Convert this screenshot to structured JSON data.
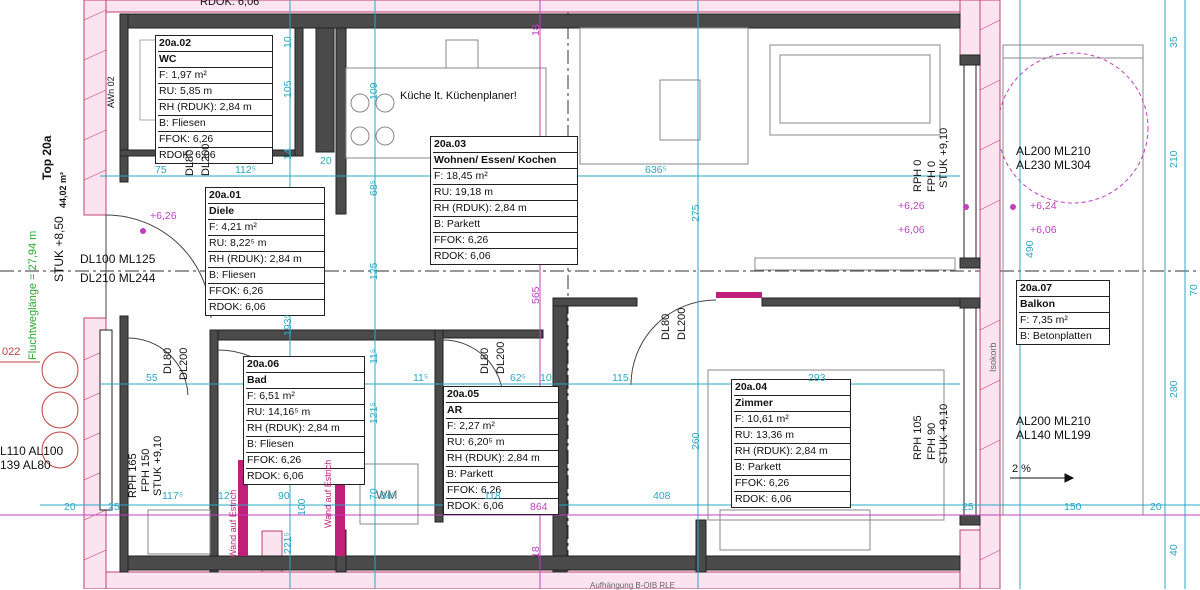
{
  "rooms": [
    {
      "id": "wc",
      "number": "20a.02",
      "name": "WC",
      "rows": [
        "F: 1,97 m²",
        "RU: 5,85 m",
        "RH (RDUK): 2,84 m",
        "B: Fliesen",
        "FFOK: 6,26",
        "RDOK: 6,06"
      ]
    },
    {
      "id": "diele",
      "number": "20a.01",
      "name": "Diele",
      "rows": [
        "F: 4,21 m²",
        "RU: 8,22⁵ m",
        "RH (RDUK): 2,84 m",
        "B: Fliesen",
        "FFOK: 6,26",
        "RDOK: 6,06"
      ]
    },
    {
      "id": "wohnen",
      "number": "20a.03",
      "name": "Wohnen/ Essen/ Kochen",
      "rows": [
        "F: 18,45 m²",
        "RU: 19,18 m",
        "RH (RDUK): 2,84 m",
        "B: Parkett",
        "FFOK: 6,26",
        "RDOK: 6,06"
      ]
    },
    {
      "id": "bad",
      "number": "20a.06",
      "name": "Bad",
      "rows": [
        "F: 6,51 m²",
        "RU: 14,16⁵ m",
        "RH (RDUK): 2,84 m",
        "B: Fliesen",
        "FFOK: 6,26",
        "RDOK: 6,06"
      ]
    },
    {
      "id": "ar",
      "number": "20a.05",
      "name": "AR",
      "rows": [
        "F: 2,27 m²",
        "RU: 6,20⁵ m",
        "RH (RDUK): 2,84 m",
        "B: Parkett",
        "FFOK: 6,26",
        "RDOK: 6,06"
      ]
    },
    {
      "id": "zimmer",
      "number": "20a.04",
      "name": "Zimmer",
      "rows": [
        "F: 10,61 m²",
        "RU: 13,36 m",
        "RH (RDUK): 2,84 m",
        "B: Parkett",
        "FFOK: 6,26",
        "RDOK: 6,06"
      ]
    },
    {
      "id": "balkon",
      "number": "20a.07",
      "name": "Balkon",
      "rows": [
        "F: 7,35 m²",
        "B: Betonplatten"
      ]
    }
  ],
  "notes": {
    "kitchen": "Küche lt. Küchenplaner!",
    "unit_top": "Top 20a",
    "unit_area": "44,02 m²",
    "escape_route": "Fluchtweglänge = 27,94 m",
    "wm": "WM",
    "awn": "AWn 02",
    "isokorb": "Isokorb",
    "slope": "2 %",
    "rdok_top": "RDOK: 6,06",
    "lower_text": "Aufhängung B-OIB RLE",
    "wall_note": "Wand auf Estrich",
    "level_022": "022"
  },
  "openings": {
    "entry_dl": "DL100  ML125",
    "entry_dl2": "DL210  ML244",
    "entry_stuk": "STUK +8,50",
    "door_dl80": "DL80",
    "door_dl200": "DL200",
    "win_top_1": "AL200  ML210",
    "win_top_2": "AL230  ML304",
    "win_low_1": "AL200  ML210",
    "win_low_2": "AL140  ML199",
    "left_win_1": "L110  AL100",
    "left_win_2": "139  AL80",
    "rph_top": "RPH 0",
    "fph_top": "FPH 0",
    "stuk_top": "STUK +9,10",
    "rph_low": "RPH 105",
    "fph_low": "FPH 90",
    "stuk_low": "STUK +9,10",
    "rph_left": "RPH 165",
    "fph_left": "FPH 150",
    "stuk_left": "STUK +9,10"
  },
  "levels": {
    "l1": "+6,26",
    "l2": "+6,24",
    "l3": "+6,06",
    "l4": "+6,06",
    "l5": "+6,26"
  },
  "dims": {
    "d75": "75",
    "d112": "112⁵",
    "d20": "20",
    "d636": "636⁵",
    "d55": "55",
    "d115a": "11⁵",
    "d62": "62⁵",
    "d10": "10",
    "d115": "115",
    "d293": "293",
    "d117": "117⁵",
    "d12": "12",
    "d90": "90",
    "d84": "84⁵",
    "d118": "118",
    "d408": "408",
    "d864": "864",
    "d20b": "20",
    "d25": "25",
    "d25b": "25",
    "d150": "150",
    "d20c": "20",
    "v10": "10",
    "v105": "105",
    "v14": "14",
    "v109": "109",
    "v68": "68⁵",
    "v125": "125",
    "v193": "193⁵",
    "v115": "11⁵",
    "v121": "121⁵",
    "v100": "100",
    "v221": "221⁵",
    "v70": "70",
    "v18": "18",
    "v275": "275",
    "v565": "565",
    "v260": "260",
    "v35": "35",
    "v210": "210",
    "v490": "490",
    "v70b": "70",
    "v280": "280",
    "v40": "40",
    "v18b": "18"
  }
}
